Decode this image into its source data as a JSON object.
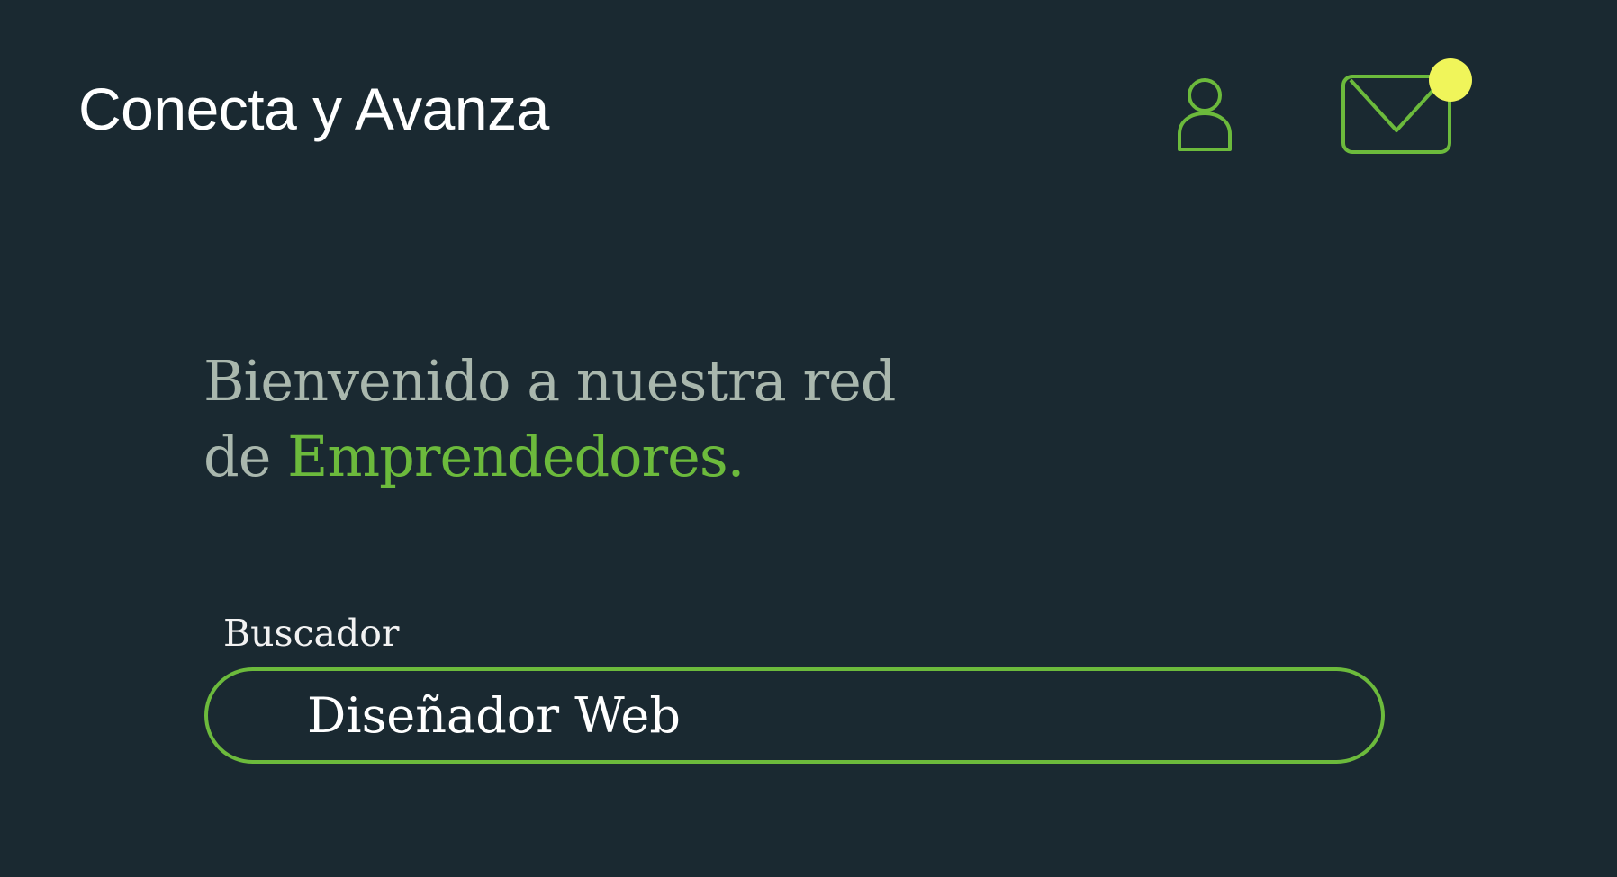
{
  "header": {
    "title": "Conecta y Avanza",
    "profile_icon": "user-icon",
    "messages_icon": "mail-icon",
    "has_notification": true
  },
  "welcome": {
    "line1": "Bienvenido a nuestra red",
    "line2_prefix": "de ",
    "line2_highlight": "Emprendedores."
  },
  "search": {
    "label": "Buscador",
    "value": "Diseñador Web"
  },
  "colors": {
    "background": "#1a2931",
    "accent": "#6cba3c",
    "notification": "#f0f55a",
    "welcome_text": "#a9b7ad",
    "title_text": "#ffffff"
  }
}
